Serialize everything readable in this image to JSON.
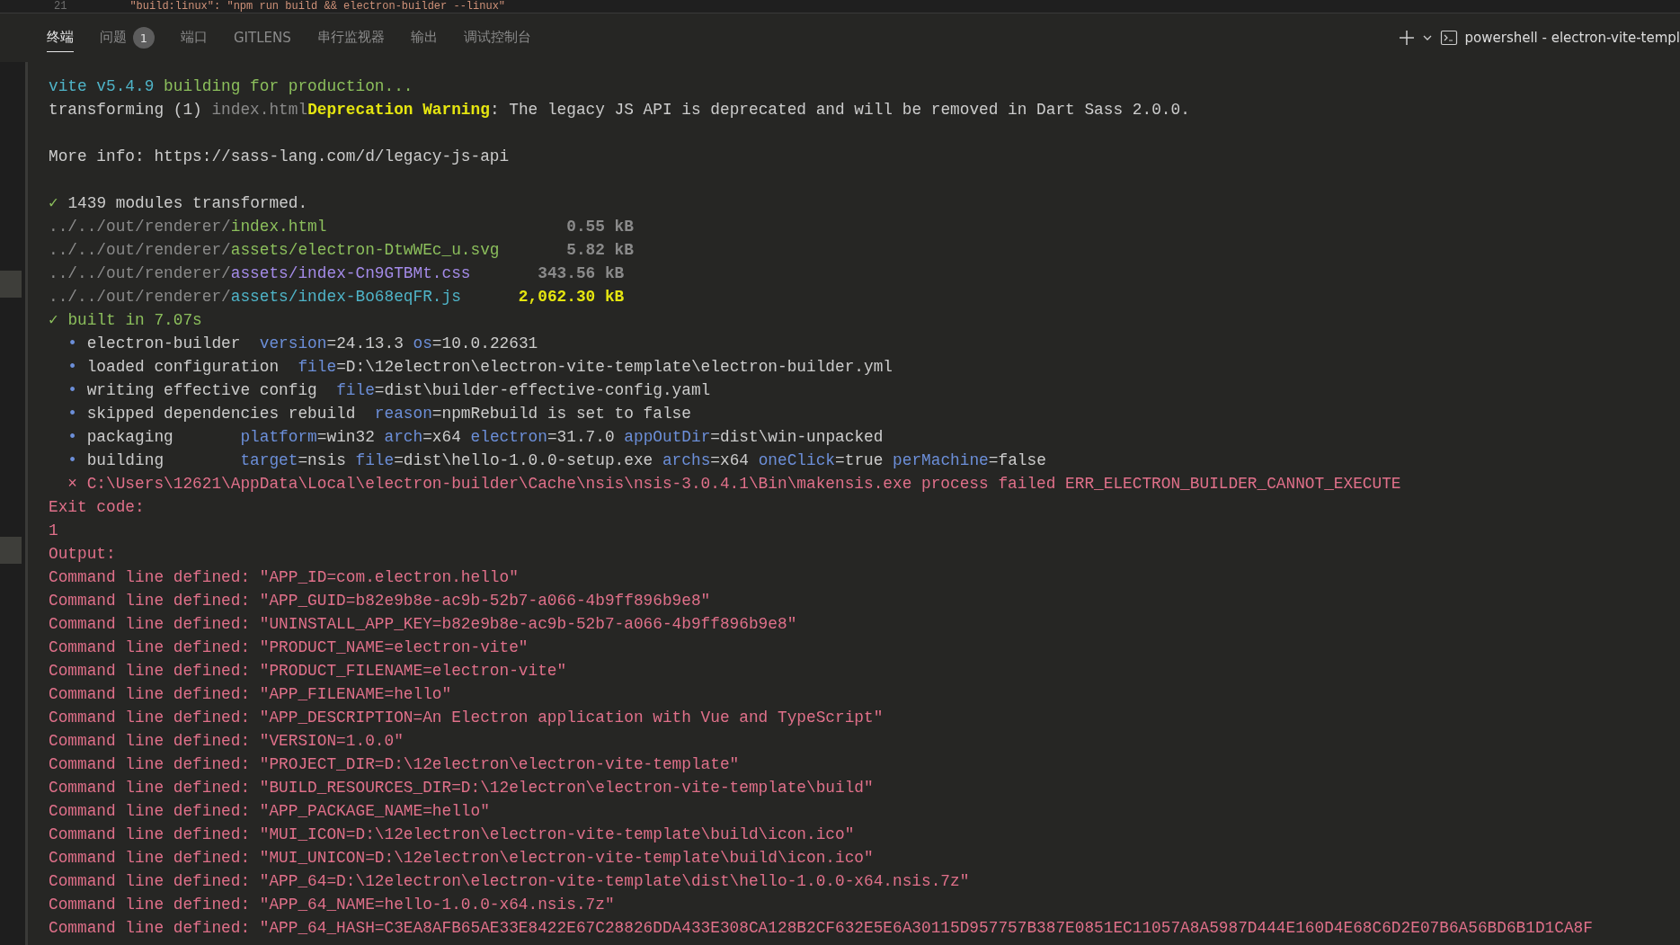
{
  "editor_line": {
    "line_number": "21",
    "text": "\"build:linux\": \"npm run build && electron-builder --linux\""
  },
  "panel_tabs": [
    {
      "label": "终端",
      "selected": true
    },
    {
      "label": "问题",
      "selected": false,
      "badge": "1"
    },
    {
      "label": "端口",
      "selected": false
    },
    {
      "label": "GITLENS",
      "selected": false
    },
    {
      "label": "串行监视器",
      "selected": false
    },
    {
      "label": "输出",
      "selected": false
    },
    {
      "label": "调试控制台",
      "selected": false
    }
  ],
  "terminal_title": "powershell - electron-vite-templ",
  "terminal_lines": [
    {
      "kind": "text",
      "segments": [
        {
          "text": "vite v5.4.9",
          "color": "#4fb4c8",
          "bold": false
        },
        {
          "text": " building for production...",
          "color": "#8cbf5c",
          "bold": false
        }
      ]
    },
    {
      "kind": "text",
      "segments": [
        {
          "text": "transforming (1) ",
          "color": "#cccccc",
          "bold": false
        },
        {
          "text": "index.html",
          "color": "#8a8a8a",
          "bold": false
        },
        {
          "text": "Deprecation Warning",
          "color": "#e5e510",
          "bold": true
        },
        {
          "text": ": The legacy JS API is deprecated and will be removed in Dart Sass 2.0.0.",
          "color": "#cccccc",
          "bold": false
        }
      ]
    },
    {
      "kind": "blank"
    },
    {
      "kind": "text",
      "segments": [
        {
          "text": "More info: https://sass-lang.com/d/legacy-js-api",
          "color": "#cccccc",
          "bold": false
        }
      ]
    },
    {
      "kind": "blank"
    },
    {
      "kind": "text",
      "segments": [
        {
          "text": "✓",
          "color": "#8cbf5c"
        },
        {
          "text": " 1439 modules transformed.",
          "color": "#cccccc",
          "bold": false
        }
      ]
    },
    {
      "kind": "text",
      "segments": [
        {
          "text": "../../out/renderer/",
          "color": "#8a8a8a",
          "bold": false
        },
        {
          "text": "index.html",
          "color": "#8cbf5c",
          "bold": false
        },
        {
          "text": "                         0.55 kB",
          "color": "#8a8a8a",
          "bold": true
        }
      ]
    },
    {
      "kind": "text",
      "segments": [
        {
          "text": "../../out/renderer/",
          "color": "#8a8a8a",
          "bold": false
        },
        {
          "text": "assets/electron-DtwWEc_u.svg",
          "color": "#8cbf5c",
          "bold": false
        },
        {
          "text": "       5.82 kB",
          "color": "#8a8a8a",
          "bold": true
        }
      ]
    },
    {
      "kind": "text",
      "segments": [
        {
          "text": "../../out/renderer/",
          "color": "#8a8a8a",
          "bold": false
        },
        {
          "text": "assets/index-Cn9GTBMt.css",
          "color": "#a48be8",
          "bold": false
        },
        {
          "text": "       343.56 kB",
          "color": "#8a8a8a",
          "bold": true
        }
      ]
    },
    {
      "kind": "text",
      "segments": [
        {
          "text": "../../out/renderer/",
          "color": "#8a8a8a",
          "bold": false
        },
        {
          "text": "assets/index-Bo68eqFR.js",
          "color": "#4fb4c8",
          "bold": false
        },
        {
          "text": "      2,062.30 kB",
          "color": "#e5e510",
          "bold": true
        }
      ]
    },
    {
      "kind": "text",
      "segments": [
        {
          "text": "✓ built in 7.07s",
          "color": "#8cbf5c",
          "bold": false
        }
      ]
    },
    {
      "kind": "text",
      "segments": [
        {
          "text": "  • ",
          "color": "#6c8fd9",
          "bold": false
        },
        {
          "text": "electron-builder  ",
          "color": "#cccccc",
          "bold": false
        },
        {
          "text": "version",
          "color": "#6c8fd9",
          "bold": false
        },
        {
          "text": "=24.13.3 ",
          "color": "#cccccc",
          "bold": false
        },
        {
          "text": "os",
          "color": "#6c8fd9",
          "bold": false
        },
        {
          "text": "=10.0.22631",
          "color": "#cccccc",
          "bold": false
        }
      ]
    },
    {
      "kind": "text",
      "segments": [
        {
          "text": "  • ",
          "color": "#6c8fd9",
          "bold": false
        },
        {
          "text": "loaded configuration  ",
          "color": "#cccccc",
          "bold": false
        },
        {
          "text": "file",
          "color": "#6c8fd9",
          "bold": false
        },
        {
          "text": "=D:\\12electron\\electron-vite-template\\electron-builder.yml",
          "color": "#cccccc",
          "bold": false
        }
      ]
    },
    {
      "kind": "text",
      "segments": [
        {
          "text": "  • ",
          "color": "#6c8fd9",
          "bold": false
        },
        {
          "text": "writing effective config  ",
          "color": "#cccccc",
          "bold": false
        },
        {
          "text": "file",
          "color": "#6c8fd9",
          "bold": false
        },
        {
          "text": "=dist\\builder-effective-config.yaml",
          "color": "#cccccc",
          "bold": false
        }
      ]
    },
    {
      "kind": "text",
      "segments": [
        {
          "text": "  • ",
          "color": "#6c8fd9",
          "bold": false
        },
        {
          "text": "skipped dependencies rebuild  ",
          "color": "#cccccc",
          "bold": false
        },
        {
          "text": "reason",
          "color": "#6c8fd9",
          "bold": false
        },
        {
          "text": "=npmRebuild is set to false",
          "color": "#cccccc",
          "bold": false
        }
      ]
    },
    {
      "kind": "text",
      "segments": [
        {
          "text": "  • ",
          "color": "#6c8fd9",
          "bold": false
        },
        {
          "text": "packaging       ",
          "color": "#cccccc",
          "bold": false
        },
        {
          "text": "platform",
          "color": "#6c8fd9",
          "bold": false
        },
        {
          "text": "=win32 ",
          "color": "#cccccc",
          "bold": false
        },
        {
          "text": "arch",
          "color": "#6c8fd9",
          "bold": false
        },
        {
          "text": "=x64 ",
          "color": "#cccccc",
          "bold": false
        },
        {
          "text": "electron",
          "color": "#6c8fd9",
          "bold": false
        },
        {
          "text": "=31.7.0 ",
          "color": "#cccccc",
          "bold": false
        },
        {
          "text": "appOutDir",
          "color": "#6c8fd9",
          "bold": false
        },
        {
          "text": "=dist\\win-unpacked",
          "color": "#cccccc",
          "bold": false
        }
      ]
    },
    {
      "kind": "text",
      "segments": [
        {
          "text": "  • ",
          "color": "#6c8fd9",
          "bold": false
        },
        {
          "text": "building        ",
          "color": "#cccccc",
          "bold": false
        },
        {
          "text": "target",
          "color": "#6c8fd9",
          "bold": false
        },
        {
          "text": "=nsis ",
          "color": "#cccccc",
          "bold": false
        },
        {
          "text": "file",
          "color": "#6c8fd9",
          "bold": false
        },
        {
          "text": "=dist\\hello-1.0.0-setup.exe ",
          "color": "#cccccc",
          "bold": false
        },
        {
          "text": "archs",
          "color": "#6c8fd9",
          "bold": false
        },
        {
          "text": "=x64 ",
          "color": "#cccccc",
          "bold": false
        },
        {
          "text": "oneClick",
          "color": "#6c8fd9",
          "bold": false
        },
        {
          "text": "=true ",
          "color": "#cccccc",
          "bold": false
        },
        {
          "text": "perMachine",
          "color": "#6c8fd9",
          "bold": false
        },
        {
          "text": "=false",
          "color": "#cccccc",
          "bold": false
        }
      ]
    },
    {
      "kind": "text",
      "segments": [
        {
          "text": "  × C:\\Users\\12621\\AppData\\Local\\electron-builder\\Cache\\nsis\\nsis-3.0.4.1\\Bin\\makensis.exe process failed ERR_ELECTRON_BUILDER_CANNOT_EXECUTE",
          "color": "#e0708a",
          "bold": false
        }
      ]
    },
    {
      "kind": "text",
      "segments": [
        {
          "text": "Exit code:",
          "color": "#e0708a",
          "bold": false
        }
      ]
    },
    {
      "kind": "text",
      "segments": [
        {
          "text": "1",
          "color": "#e0708a",
          "bold": false
        }
      ]
    },
    {
      "kind": "text",
      "segments": [
        {
          "text": "Output:",
          "color": "#e0708a",
          "bold": false
        }
      ]
    },
    {
      "kind": "text",
      "segments": [
        {
          "text": "Command line defined: \"APP_ID=com.electron.hello\"",
          "color": "#e0708a",
          "bold": false
        }
      ]
    },
    {
      "kind": "text",
      "segments": [
        {
          "text": "Command line defined: \"APP_GUID=b82e9b8e-ac9b-52b7-a066-4b9ff896b9e8\"",
          "color": "#e0708a",
          "bold": false
        }
      ]
    },
    {
      "kind": "text",
      "segments": [
        {
          "text": "Command line defined: \"UNINSTALL_APP_KEY=b82e9b8e-ac9b-52b7-a066-4b9ff896b9e8\"",
          "color": "#e0708a",
          "bold": false
        }
      ]
    },
    {
      "kind": "text",
      "segments": [
        {
          "text": "Command line defined: \"PRODUCT_NAME=electron-vite\"",
          "color": "#e0708a",
          "bold": false
        }
      ]
    },
    {
      "kind": "text",
      "segments": [
        {
          "text": "Command line defined: \"PRODUCT_FILENAME=electron-vite\"",
          "color": "#e0708a",
          "bold": false
        }
      ]
    },
    {
      "kind": "text",
      "segments": [
        {
          "text": "Command line defined: \"APP_FILENAME=hello\"",
          "color": "#e0708a",
          "bold": false
        }
      ]
    },
    {
      "kind": "text",
      "segments": [
        {
          "text": "Command line defined: \"APP_DESCRIPTION=An Electron application with Vue and TypeScript\"",
          "color": "#e0708a",
          "bold": false
        }
      ]
    },
    {
      "kind": "text",
      "segments": [
        {
          "text": "Command line defined: \"VERSION=1.0.0\"",
          "color": "#e0708a",
          "bold": false
        }
      ]
    },
    {
      "kind": "text",
      "segments": [
        {
          "text": "Command line defined: \"PROJECT_DIR=D:\\12electron\\electron-vite-template\"",
          "color": "#e0708a",
          "bold": false
        }
      ]
    },
    {
      "kind": "text",
      "segments": [
        {
          "text": "Command line defined: \"BUILD_RESOURCES_DIR=D:\\12electron\\electron-vite-template\\build\"",
          "color": "#e0708a",
          "bold": false
        }
      ]
    },
    {
      "kind": "text",
      "segments": [
        {
          "text": "Command line defined: \"APP_PACKAGE_NAME=hello\"",
          "color": "#e0708a",
          "bold": false
        }
      ]
    },
    {
      "kind": "text",
      "segments": [
        {
          "text": "Command line defined: \"MUI_ICON=D:\\12electron\\electron-vite-template\\build\\icon.ico\"",
          "color": "#e0708a",
          "bold": false
        }
      ]
    },
    {
      "kind": "text",
      "segments": [
        {
          "text": "Command line defined: \"MUI_UNICON=D:\\12electron\\electron-vite-template\\build\\icon.ico\"",
          "color": "#e0708a",
          "bold": false
        }
      ]
    },
    {
      "kind": "text",
      "segments": [
        {
          "text": "Command line defined: \"APP_64=D:\\12electron\\electron-vite-template\\dist\\hello-1.0.0-x64.nsis.7z\"",
          "color": "#e0708a",
          "bold": false
        }
      ]
    },
    {
      "kind": "text",
      "segments": [
        {
          "text": "Command line defined: \"APP_64_NAME=hello-1.0.0-x64.nsis.7z\"",
          "color": "#e0708a",
          "bold": false
        }
      ]
    },
    {
      "kind": "text",
      "segments": [
        {
          "text": "Command line defined: \"APP_64_HASH=C3EA8AFB65AE33E8422E67C28826DDA433E308CA128B2CF632E5E6A30115D957757B387E0851EC11057A8A5987D444E160D4E68C6D2E07B6A56BD6B1D1CA8F",
          "color": "#e0708a",
          "bold": false
        }
      ]
    }
  ]
}
